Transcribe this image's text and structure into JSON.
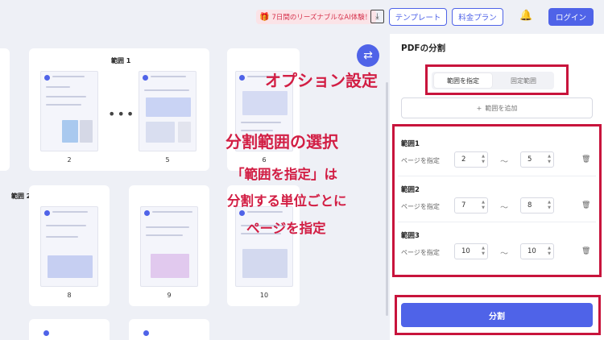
{
  "header": {
    "promo_icon": "🎁",
    "promo_text": "7日間のリーズナブルなAI体験！",
    "download_icon": "download-icon",
    "template_label": "テンプレート",
    "pricing_label": "料金プラン",
    "bell_icon": "bell-icon",
    "login_label": "ログイン"
  },
  "canvas": {
    "groups": [
      {
        "label": "範囲 1",
        "pages": [
          "2",
          "5",
          "6"
        ],
        "ellipsis": "•••"
      },
      {
        "label": "範囲 2",
        "pages": [
          "8",
          "9",
          "10"
        ]
      }
    ],
    "swap_icon": "⇄"
  },
  "panel": {
    "title": "PDFの分割",
    "mode_active": "範囲を指定",
    "mode_inactive": "固定範囲",
    "add_range_label": "範囲を追加",
    "add_icon": "+",
    "page_label": "ページを指定",
    "tilde": "～",
    "trash_icon": "🗑",
    "ranges": [
      {
        "name": "範囲1",
        "from": "2",
        "to": "5"
      },
      {
        "name": "範囲2",
        "from": "7",
        "to": "8"
      },
      {
        "name": "範囲3",
        "from": "10",
        "to": "10"
      }
    ],
    "split_label": "分割"
  },
  "annotations": {
    "option_setting": "オプション設定",
    "range_select": "分割範囲の選択",
    "desc_line1": "「範囲を指定」は",
    "desc_line2": "分割する単位ごとに",
    "desc_line3": "ページを指定"
  },
  "colors": {
    "accent": "#4f63e8",
    "annotation_red": "#c8143c",
    "promo_red": "#d6334d"
  }
}
